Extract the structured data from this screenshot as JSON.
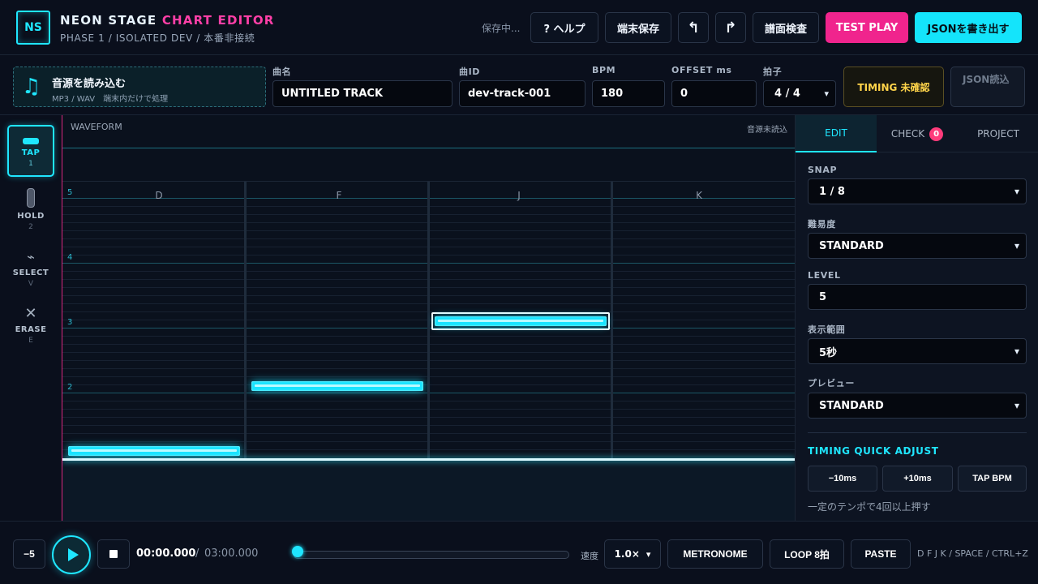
{
  "header": {
    "logo": "NS",
    "title_main": "NEON STAGE",
    "title_accent": "CHART EDITOR",
    "subtitle": "PHASE 1 / ISOLATED DEV / 本番非接続",
    "saving": "保存中...",
    "help_label": "? ヘルプ",
    "device_save_label": "端末保存",
    "undo_glyph": "↰",
    "redo_glyph": "↱",
    "inspect_label": "譜面検査",
    "test_play_label": "TEST PLAY",
    "export_json_label": "JSONを書き出す"
  },
  "topbar": {
    "audio_title": "音源を読み込む",
    "audio_formats": "MP3 / WAV　端末内だけで処理",
    "song_name_label": "曲名",
    "song_name_value": "UNTITLED TRACK",
    "song_id_label": "曲ID",
    "song_id_value": "dev-track-001",
    "bpm_label": "BPM",
    "bpm_value": "180",
    "offset_label": "OFFSET ms",
    "offset_value": "0",
    "meter_label": "拍子",
    "meter_value": "4 / 4",
    "timing_status": "TIMING 未確認",
    "json_load_label": "JSON読込"
  },
  "tools": [
    {
      "name": "TAP",
      "key": "1",
      "icon": "tap-icon"
    },
    {
      "name": "HOLD",
      "key": "2",
      "icon": "hold-icon"
    },
    {
      "name": "SELECT",
      "key": "V",
      "icon": "select-icon",
      "glyph": "⌁"
    },
    {
      "name": "ERASE",
      "key": "E",
      "icon": "erase-icon",
      "glyph": "✕"
    }
  ],
  "editor": {
    "waveform_label": "WAVEFORM",
    "waveform_status": "音源未読込",
    "lanes": [
      "D",
      "F",
      "J",
      "K"
    ],
    "beats": [
      "5",
      "4",
      "3",
      "2"
    ]
  },
  "panel": {
    "tabs": {
      "edit": "EDIT",
      "check": "CHECK",
      "check_count": "0",
      "project": "PROJECT"
    },
    "snap_label": "SNAP",
    "snap_value": "1 / 8",
    "difficulty_label": "難易度",
    "difficulty_value": "STANDARD",
    "level_label": "LEVEL",
    "level_value": "5",
    "range_label": "表示範囲",
    "range_value": "5秒",
    "preview_label": "プレビュー",
    "preview_value": "STANDARD",
    "quick_title": "TIMING QUICK ADJUST",
    "minus10": "−10ms",
    "plus10": "+10ms",
    "tap_bpm": "TAP BPM",
    "quick_hint": "一定のテンポで4回以上押す"
  },
  "bottombar": {
    "minus5": "−5",
    "time_current": "00:00.000",
    "time_sep": "/",
    "time_total": "03:00.000",
    "seek_progress": 0,
    "speed_label": "速度",
    "speed_value": "1.0×",
    "metronome": "METRONOME",
    "loop": "LOOP 8拍",
    "paste": "PASTE",
    "keys_hint": "D F J K / SPACE / CTRL+Z"
  },
  "colors": {
    "accent_cyan": "#1fe6ff",
    "accent_pink": "#f0248d",
    "warning_yellow": "#ffd44a",
    "background": "#070b14"
  }
}
